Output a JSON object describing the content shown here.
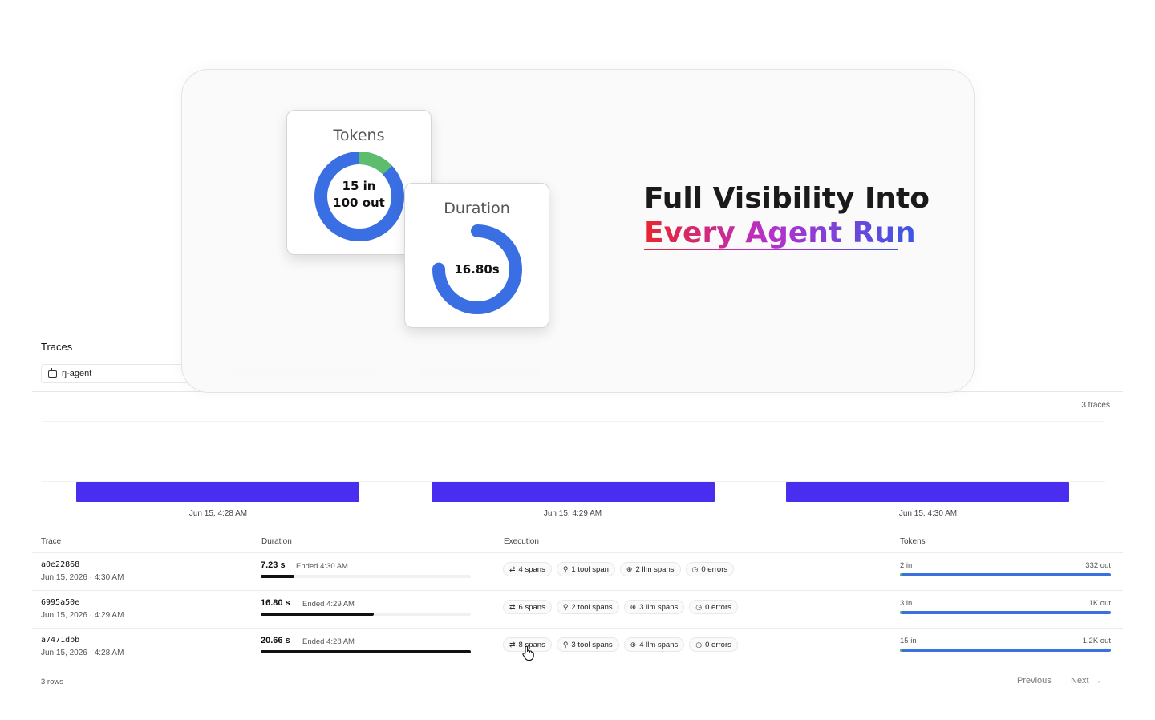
{
  "page": {
    "title": "Traces",
    "agent_filter": "rj-agent",
    "trace_count": "3 traces"
  },
  "timeline": {
    "labels": [
      "Jun 15, 4:28 AM",
      "Jun 15, 4:29 AM",
      "Jun 15, 4:30 AM"
    ],
    "bar_color": "#4a2ef0"
  },
  "table": {
    "columns": [
      "Trace",
      "Duration",
      "Execution",
      "Tokens"
    ],
    "rows": [
      {
        "id": "a0e22868",
        "date": "Jun 15, 2026 · 4:30 AM",
        "duration": "7.23 s",
        "ended": "Ended 4:30 AM",
        "duration_fraction": 0.16,
        "spans": "4 spans",
        "tool_spans": "1 tool span",
        "llm_spans": "2 llm spans",
        "errors": "0 errors",
        "tokens_in": "2 in",
        "tokens_out": "332 out",
        "tokens_in_fraction": 0.006
      },
      {
        "id": "6995a50e",
        "date": "Jun 15, 2026 · 4:29 AM",
        "duration": "16.80 s",
        "ended": "Ended 4:29 AM",
        "duration_fraction": 0.54,
        "spans": "6 spans",
        "tool_spans": "2 tool spans",
        "llm_spans": "3 llm spans",
        "errors": "0 errors",
        "tokens_in": "3 in",
        "tokens_out": "1K out",
        "tokens_in_fraction": 0.003
      },
      {
        "id": "a7471dbb",
        "date": "Jun 15, 2026 · 4:28 AM",
        "duration": "20.66 s",
        "ended": "Ended 4:28 AM",
        "duration_fraction": 1.0,
        "spans": "8 spans",
        "tool_spans": "3 tool spans",
        "llm_spans": "4 llm spans",
        "errors": "0 errors",
        "tokens_in": "15 in",
        "tokens_out": "1.2K out",
        "tokens_in_fraction": 0.012
      }
    ],
    "rows_count": "3 rows"
  },
  "pagination": {
    "previous": "Previous",
    "next": "Next"
  },
  "hero": {
    "tokens_card": {
      "title": "Tokens",
      "line1": "15 in",
      "line2": "100 out",
      "in_fraction": 0.13,
      "in_color": "#5cbd6f",
      "out_color": "#3a6fe3"
    },
    "duration_card": {
      "title": "Duration",
      "value": "16.80s",
      "fraction": 0.75,
      "color": "#3a6fe3"
    },
    "headline_line1": "Full Visibility Into",
    "headline_line2": "Every Agent Run"
  },
  "icons": {
    "spans": "branch-icon",
    "tool": "wrench-icon",
    "llm": "llm-icon",
    "errors": "clock-icon"
  }
}
